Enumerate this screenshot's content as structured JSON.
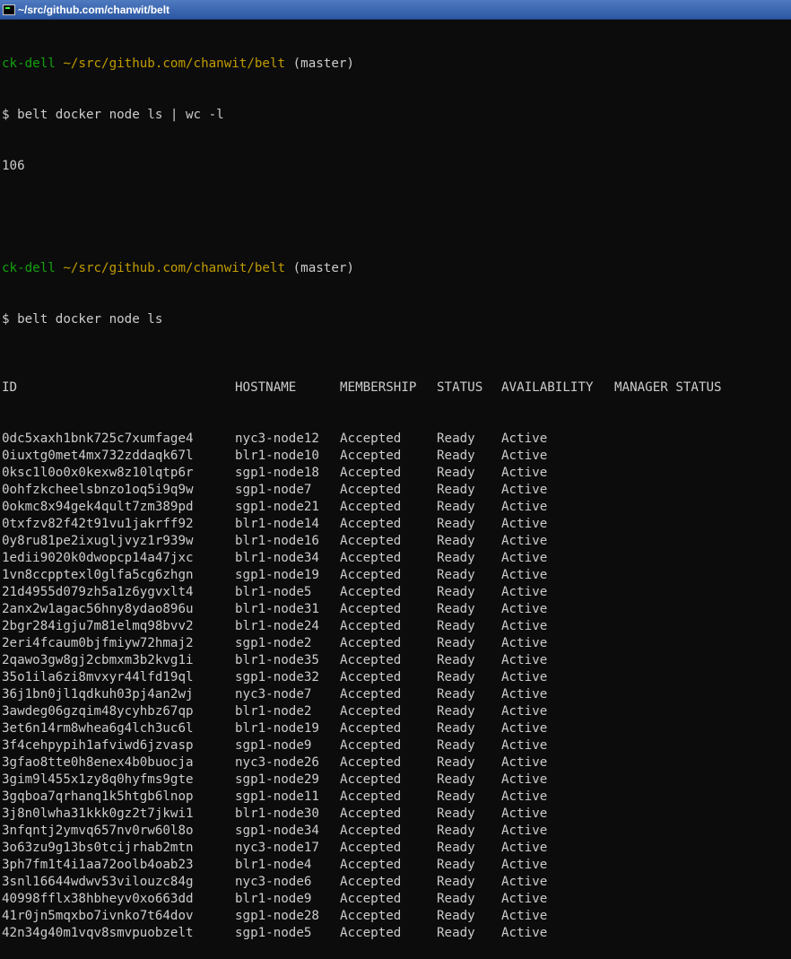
{
  "window": {
    "title": "~/src/github.com/chanwit/belt"
  },
  "blocks": [
    {
      "prompt": {
        "user": "ck-dell",
        "path": "~/src/github.com/chanwit/belt",
        "branch": "(master)"
      },
      "command": "$ belt docker node ls | wc -l",
      "output": "106"
    },
    {
      "prompt": {
        "user": "ck-dell",
        "path": "~/src/github.com/chanwit/belt",
        "branch": "(master)"
      },
      "command": "$ belt docker node ls"
    }
  ],
  "table": {
    "headers": [
      "ID",
      "HOSTNAME",
      "MEMBERSHIP",
      "STATUS",
      "AVAILABILITY",
      "MANAGER STATUS"
    ],
    "rows": [
      [
        "0dc5xaxh1bnk725c7xumfage4",
        "nyc3-node12",
        "Accepted",
        "Ready",
        "Active"
      ],
      [
        "0iuxtg0met4mx732zddaqk67l",
        "blr1-node10",
        "Accepted",
        "Ready",
        "Active"
      ],
      [
        "0ksc1l0o0x0kexw8z10lqtp6r",
        "sgp1-node18",
        "Accepted",
        "Ready",
        "Active"
      ],
      [
        "0ohfzkcheelsbnzo1oq5i9q9w",
        "sgp1-node7",
        "Accepted",
        "Ready",
        "Active"
      ],
      [
        "0okmc8x94gek4qult7zm389pd",
        "sgp1-node21",
        "Accepted",
        "Ready",
        "Active"
      ],
      [
        "0txfzv82f42t91vu1jakrff92",
        "blr1-node14",
        "Accepted",
        "Ready",
        "Active"
      ],
      [
        "0y8ru81pe2ixugljvyz1r939w",
        "blr1-node16",
        "Accepted",
        "Ready",
        "Active"
      ],
      [
        "1edii9020k0dwopcp14a47jxc",
        "blr1-node34",
        "Accepted",
        "Ready",
        "Active"
      ],
      [
        "1vn8ccpptexl0glfa5cg6zhgn",
        "sgp1-node19",
        "Accepted",
        "Ready",
        "Active"
      ],
      [
        "21d4955d079zh5a1z6ygvxlt4",
        "blr1-node5",
        "Accepted",
        "Ready",
        "Active"
      ],
      [
        "2anx2w1agac56hny8ydao896u",
        "blr1-node31",
        "Accepted",
        "Ready",
        "Active"
      ],
      [
        "2bgr284igju7m81elmq98bvv2",
        "blr1-node24",
        "Accepted",
        "Ready",
        "Active"
      ],
      [
        "2eri4fcaum0bjfmiyw72hmaj2",
        "sgp1-node2",
        "Accepted",
        "Ready",
        "Active"
      ],
      [
        "2qawo3gw8gj2cbmxm3b2kvg1i",
        "blr1-node35",
        "Accepted",
        "Ready",
        "Active"
      ],
      [
        "35o1ila6zi8mvxyr44lfd19ql",
        "sgp1-node32",
        "Accepted",
        "Ready",
        "Active"
      ],
      [
        "36j1bn0jl1qdkuh03pj4an2wj",
        "nyc3-node7",
        "Accepted",
        "Ready",
        "Active"
      ],
      [
        "3awdeg06gzqim48ycyhbz67qp",
        "blr1-node2",
        "Accepted",
        "Ready",
        "Active"
      ],
      [
        "3et6n14rm8whea6g4lch3uc6l",
        "blr1-node19",
        "Accepted",
        "Ready",
        "Active"
      ],
      [
        "3f4cehpypih1afviwd6jzvasp",
        "sgp1-node9",
        "Accepted",
        "Ready",
        "Active"
      ],
      [
        "3gfao8tte0h8enex4b0buocja",
        "nyc3-node26",
        "Accepted",
        "Ready",
        "Active"
      ],
      [
        "3gim9l455x1zy8q0hyfms9gte",
        "sgp1-node29",
        "Accepted",
        "Ready",
        "Active"
      ],
      [
        "3gqboa7qrhanq1k5htgb6lnop",
        "sgp1-node11",
        "Accepted",
        "Ready",
        "Active"
      ],
      [
        "3j8n0lwha31kkk0gz2t7jkwi1",
        "blr1-node30",
        "Accepted",
        "Ready",
        "Active"
      ],
      [
        "3nfqntj2ymvq657nv0rw60l8o",
        "sgp1-node34",
        "Accepted",
        "Ready",
        "Active"
      ],
      [
        "3o63zu9g13bs0tcijrhab2mtn",
        "nyc3-node17",
        "Accepted",
        "Ready",
        "Active"
      ],
      [
        "3ph7fm1t4i1aa72oolb4oab23",
        "blr1-node4",
        "Accepted",
        "Ready",
        "Active"
      ],
      [
        "3snl16644wdwv53vilouzc84g",
        "nyc3-node6",
        "Accepted",
        "Ready",
        "Active"
      ],
      [
        "40998fflx38hbheyv0xo663dd",
        "blr1-node9",
        "Accepted",
        "Ready",
        "Active"
      ],
      [
        "41r0jn5mqxbo7ivnko7t64dov",
        "sgp1-node28",
        "Accepted",
        "Ready",
        "Active"
      ],
      [
        "42n34g40m1vqv8smvpuobzelt",
        "sgp1-node5",
        "Accepted",
        "Ready",
        "Active"
      ]
    ]
  },
  "colors": {
    "background": "#0c0c0c",
    "text": "#cccccc",
    "prompt_user": "#13a10e",
    "prompt_path": "#c19c00",
    "titlebar": "#2c58a4"
  }
}
